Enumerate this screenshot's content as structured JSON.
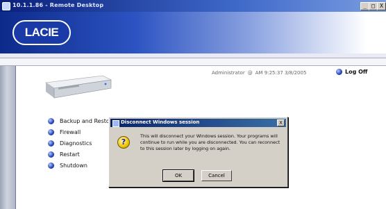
{
  "window": {
    "title": "10.1.1.86 - Remote Desktop",
    "controls": {
      "minimize": "_",
      "restore": "□",
      "close": "X"
    }
  },
  "banner": {
    "logo_text": "LACIE"
  },
  "header": {
    "user": "Administrator",
    "at": "@",
    "datetime": "AM 9:25:37 3/8/2005",
    "logoff_label": "Log Off"
  },
  "menu": {
    "items": [
      {
        "label": "Backup and Resto"
      },
      {
        "label": "Firewall"
      },
      {
        "label": "Diagnostics"
      },
      {
        "label": "Restart"
      },
      {
        "label": "Shutdown"
      }
    ]
  },
  "dialog": {
    "title": "Disconnect Windows session",
    "close": "X",
    "message": "This will disconnect your Windows session. Your programs will continue to run while you are disconnected. You can reconnect to this session later by logging on again.",
    "ok_label": "OK",
    "cancel_label": "Cancel",
    "icon": "question-icon"
  },
  "colors": {
    "titlebar": "#0a1f7a",
    "banner": "#2c53c2",
    "dialog_face": "#d4d0c8"
  }
}
